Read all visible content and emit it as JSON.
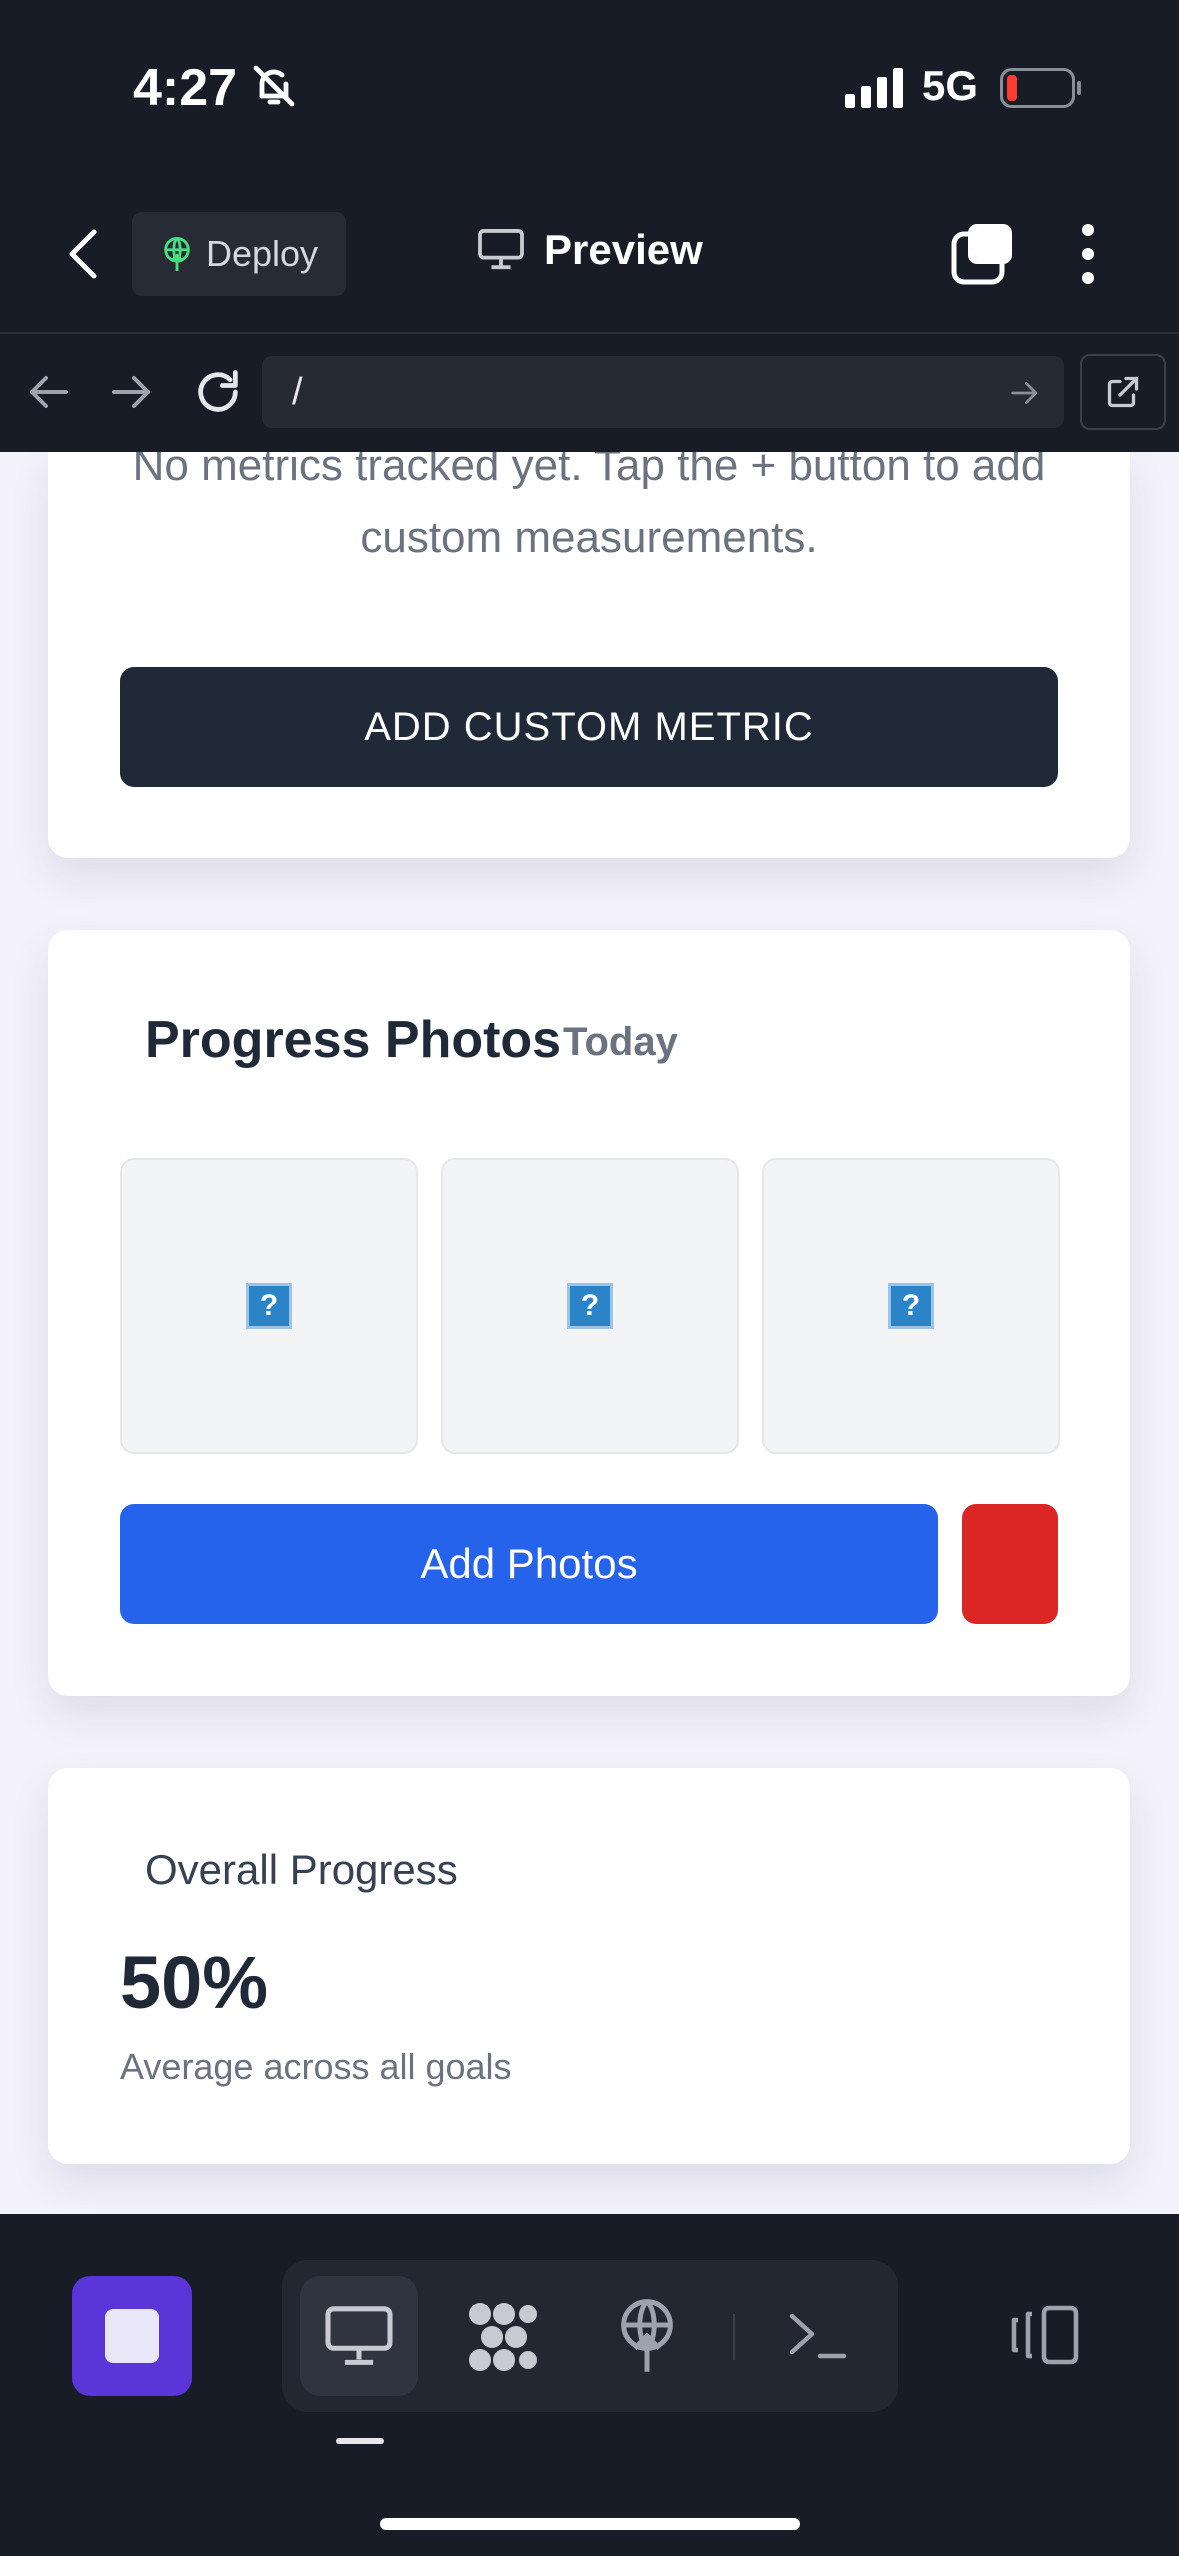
{
  "status_bar": {
    "time": "4:27",
    "network": "5G"
  },
  "nav": {
    "deploy_label": "Deploy",
    "preview_label": "Preview"
  },
  "url_bar": {
    "value": "/"
  },
  "metrics_card": {
    "empty_text": "No metrics tracked yet. Tap the + button to add custom measurements.",
    "add_button": "ADD CUSTOM METRIC"
  },
  "photos_card": {
    "title": "Progress Photos",
    "date": "Today",
    "photos": [
      "?",
      "?",
      "?"
    ],
    "add_button": "Add Photos"
  },
  "overall_card": {
    "title": "Overall Progress",
    "value": "50%",
    "subtitle": "Average across all goals"
  },
  "colors": {
    "primary_blue": "#2563eb",
    "danger_red": "#dc2626",
    "dark_button": "#1f2937",
    "stop_purple": "#5a35d8"
  }
}
